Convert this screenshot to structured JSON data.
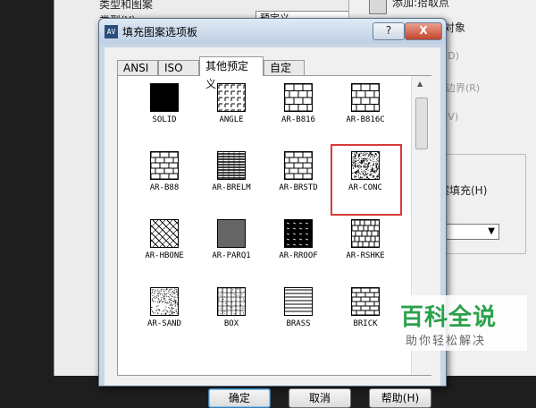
{
  "background": {
    "left_rows": [
      "类型和图案",
      "类型(Y):"
    ],
    "type_combo_value": "预定义",
    "right_items": [
      "添加:拾取点",
      "对象",
      "(D)",
      "边界(R)",
      "(V)",
      "案填充(H)"
    ]
  },
  "dialog": {
    "title": "填充图案选项板",
    "help_button": "?",
    "close_button": "X",
    "tabs": [
      {
        "label": "ANSI",
        "active": false
      },
      {
        "label": "ISO",
        "active": false
      },
      {
        "label": "其他预定义",
        "active": true
      },
      {
        "label": "自定义",
        "active": false
      }
    ],
    "patterns": [
      {
        "name": "SOLID",
        "icon": "solid-pattern-icon"
      },
      {
        "name": "ANGLE",
        "icon": "angle-pattern-icon"
      },
      {
        "name": "AR-B816",
        "icon": "brick-pattern-icon"
      },
      {
        "name": "AR-B816C",
        "icon": "brick-pattern-icon"
      },
      {
        "name": "AR-B88",
        "icon": "brick-pattern-icon"
      },
      {
        "name": "AR-BRELM",
        "icon": "brick-elm-pattern-icon"
      },
      {
        "name": "AR-BRSTD",
        "icon": "brick-pattern-icon"
      },
      {
        "name": "AR-CONC",
        "icon": "concrete-pattern-icon",
        "selected": true
      },
      {
        "name": "AR-HBONE",
        "icon": "herringbone-pattern-icon"
      },
      {
        "name": "AR-PARQ1",
        "icon": "parquet-pattern-icon"
      },
      {
        "name": "AR-RROOF",
        "icon": "roof-pattern-icon"
      },
      {
        "name": "AR-RSHKE",
        "icon": "shake-pattern-icon"
      },
      {
        "name": "AR-SAND",
        "icon": "sand-pattern-icon"
      },
      {
        "name": "BOX",
        "icon": "box-pattern-icon"
      },
      {
        "name": "BRASS",
        "icon": "brass-pattern-icon"
      },
      {
        "name": "BRICK",
        "icon": "brick-pattern-icon"
      }
    ],
    "buttons": {
      "ok": "确定",
      "cancel": "取消",
      "help": "帮助(H)"
    },
    "selection_color": "#d83a3a"
  },
  "watermark": {
    "title": "百科全说",
    "subtitle": "助你轻松解决"
  }
}
